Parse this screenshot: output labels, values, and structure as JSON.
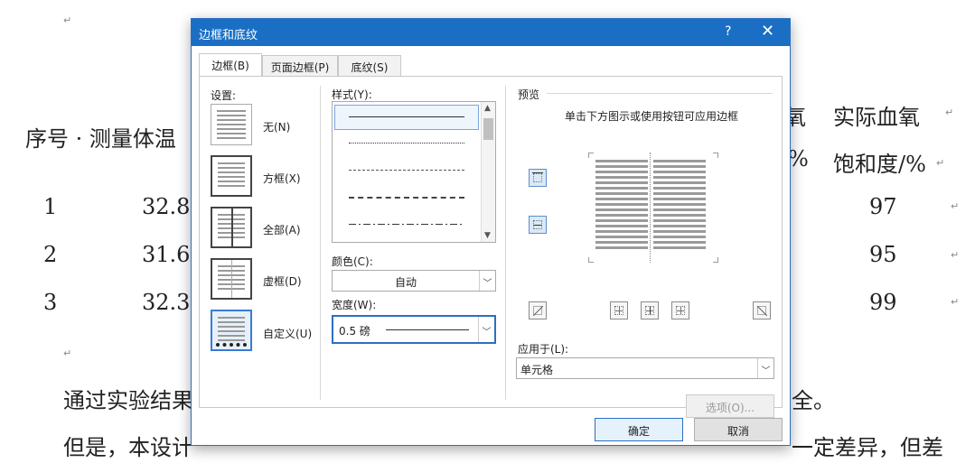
{
  "document": {
    "header_left": "序号 · 测量体温",
    "header_right_top": "实际血氧",
    "header_right_bottom": "饱和度/%",
    "col_fragment_top": "氧",
    "col_fragment_mid": "%",
    "rows": [
      {
        "idx": "1",
        "temp": "32.8",
        "spo2": "97"
      },
      {
        "idx": "2",
        "temp": "31.6",
        "spo2": "95"
      },
      {
        "idx": "3",
        "temp": "32.3",
        "spo2": "99"
      }
    ],
    "para1_start": "通过实验结果",
    "para1_end": "全。",
    "para2_start": "但是，本设计",
    "para2_end": "一定差异，但差",
    "marker": "↵"
  },
  "dialog": {
    "title": "边框和底纹",
    "help": "?",
    "close": "✕",
    "tabs": [
      "边框(B)",
      "页面边框(P)",
      "底纹(S)"
    ],
    "settings_label": "设置:",
    "settings": [
      {
        "label": "无(N)"
      },
      {
        "label": "方框(X)"
      },
      {
        "label": "全部(A)"
      },
      {
        "label": "虚框(D)"
      },
      {
        "label": "自定义(U)"
      }
    ],
    "style_label": "样式(Y):",
    "color_label": "颜色(C):",
    "color_value": "自动",
    "width_label": "宽度(W):",
    "width_value": "0.5 磅",
    "preview_label": "预览",
    "preview_hint": "单击下方图示或使用按钮可应用边框",
    "apply_label": "应用于(L):",
    "apply_value": "单元格",
    "options_button": "选项(O)...",
    "ok_button": "确定",
    "cancel_button": "取消"
  },
  "colors": {
    "titlebar": "#1a6fc4",
    "accent": "#3a7bd5"
  }
}
